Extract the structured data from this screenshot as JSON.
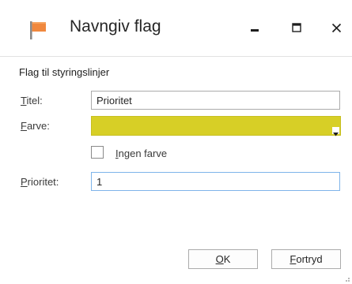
{
  "window": {
    "title": "Navngiv flag",
    "icon": "flag-icon",
    "controls": {
      "minimize": "minimize-icon",
      "maximize": "maximize-icon",
      "close": "close-icon"
    }
  },
  "form": {
    "section_label": "Flag til styringslinjer",
    "title_label": {
      "accesskey": "T",
      "rest": "itel:"
    },
    "title_value": "Prioritet",
    "color_label": {
      "accesskey": "F",
      "rest": "arve:"
    },
    "color_value": "#d7cf26",
    "no_color": {
      "accesskey": "I",
      "rest": "ngen farve",
      "checked": false
    },
    "priority_label": {
      "accesskey": "P",
      "rest": "rioritet:"
    },
    "priority_value": "1"
  },
  "buttons": {
    "ok": {
      "accesskey": "O",
      "rest": "K"
    },
    "cancel": {
      "accesskey": "F",
      "rest": "ortryd"
    }
  },
  "colors": {
    "flag": "#f0883e",
    "accent_focus": "#7eb4ea",
    "swatch": "#d7cf26"
  }
}
